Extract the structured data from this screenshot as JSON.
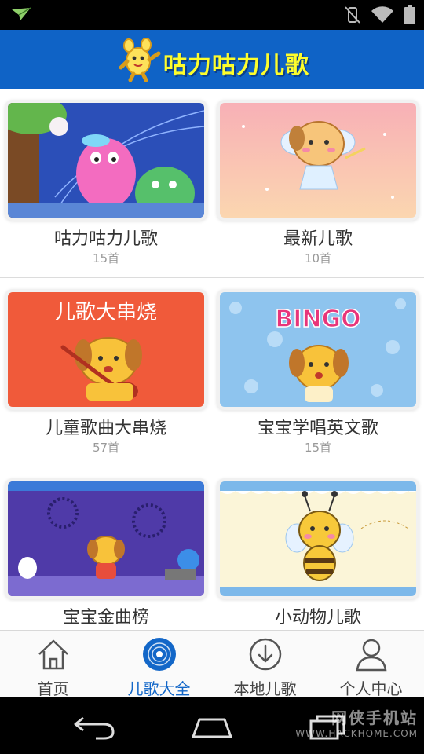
{
  "header": {
    "title": "咕力咕力儿歌"
  },
  "tiles": [
    {
      "title": "咕力咕力儿歌",
      "count": "15首",
      "color": "#cfe2f8"
    },
    {
      "title": "最新儿歌",
      "count": "10首",
      "color": "#f8c7b5"
    },
    {
      "title": "儿童歌曲大串烧",
      "count": "57首",
      "color": "#f05a3a",
      "banner": "儿歌大串烧"
    },
    {
      "title": "宝宝学唱英文歌",
      "count": "15首",
      "color": "#8ec4ee",
      "banner": "BINGO"
    },
    {
      "title": "宝宝金曲榜",
      "count": "",
      "color": "#4f3aa8"
    },
    {
      "title": "小动物儿歌",
      "count": "",
      "color": "#fbf5d8"
    }
  ],
  "tabs": [
    {
      "label": "首页",
      "icon": "home-icon",
      "active": false
    },
    {
      "label": "儿歌大全",
      "icon": "disc-icon",
      "active": true
    },
    {
      "label": "本地儿歌",
      "icon": "download-icon",
      "active": false
    },
    {
      "label": "个人中心",
      "icon": "person-icon",
      "active": false
    }
  ],
  "watermark": {
    "name": "网侠手机站",
    "url": "WWW.HACKHOME.COM"
  },
  "colors": {
    "header": "#0f63c6",
    "title": "#fdfd2c",
    "active_tab": "#1367c8"
  }
}
